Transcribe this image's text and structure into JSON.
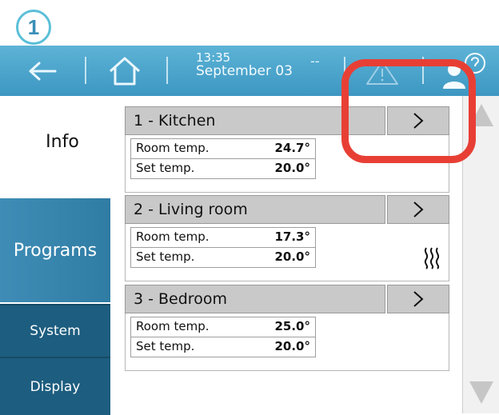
{
  "step_badge": "1",
  "topbar": {
    "time": "13:35",
    "date": "September 03",
    "status": "--",
    "icons": [
      "back-arrow-icon",
      "home-icon",
      "warning-icon",
      "user-icon"
    ]
  },
  "nav": {
    "info": "Info",
    "programs": "Programs",
    "system": "System",
    "display": "Display"
  },
  "zones": [
    {
      "title": "1 - Kitchen",
      "go": ">",
      "room_label": "Room temp.",
      "room_value": "24.7°",
      "set_label": "Set temp.",
      "set_value": "20.0°",
      "heating": false
    },
    {
      "title": "2 - Living room",
      "go": ">",
      "room_label": "Room temp.",
      "room_value": "17.3°",
      "set_label": "Set temp.",
      "set_value": "20.0°",
      "heating": true
    },
    {
      "title": "3 - Bedroom",
      "go": ">",
      "room_label": "Room temp.",
      "room_value": "25.0°",
      "set_label": "Set temp.",
      "set_value": "20.0°",
      "heating": false
    }
  ],
  "colors": {
    "topbar": "#4aa6cf",
    "nav_programs": "#3685ae",
    "nav_dark": "#1d5d7f",
    "highlight": "#e83f35",
    "zone_header": "#c9c9c9"
  }
}
